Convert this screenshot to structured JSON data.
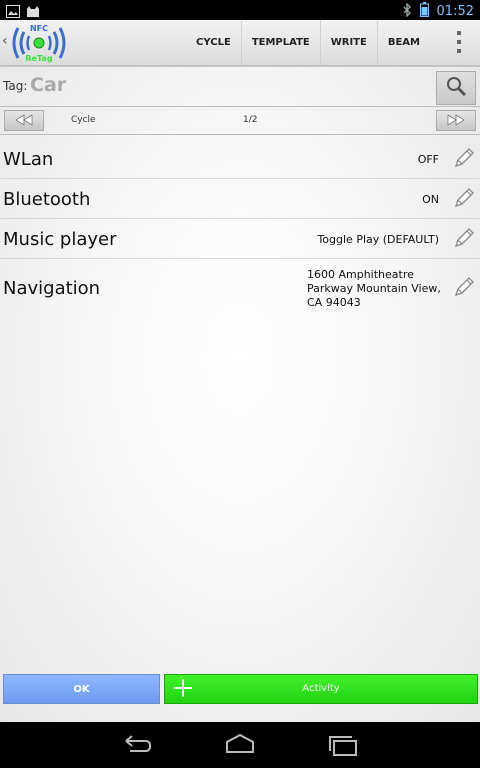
{
  "status_bar": {
    "left_icons": [
      "image-icon",
      "cat-icon"
    ],
    "right_icons": [
      "bluetooth-icon",
      "battery-icon"
    ],
    "time": "01:52"
  },
  "action_bar": {
    "logo_text_top": "NFC",
    "logo_text_bottom": "ReTag",
    "actions": [
      "CYCLE",
      "TEMPLATE",
      "WRITE",
      "BEAM"
    ],
    "overflow_icon": "overflow-menu-icon"
  },
  "tag": {
    "label": "Tag:",
    "value": "Car"
  },
  "nav": {
    "label": "Cycle",
    "page": "1/2"
  },
  "items": [
    {
      "name": "WLan",
      "value": "OFF"
    },
    {
      "name": "Bluetooth",
      "value": "ON"
    },
    {
      "name": "Music player",
      "value": "Toggle Play (DEFAULT)"
    },
    {
      "name": "Navigation",
      "value_lines": [
        "1600 Amphitheatre",
        "Parkway Mountain View,",
        "CA 94043"
      ]
    }
  ],
  "buttons": {
    "ok": "OK",
    "activity": "Activity"
  },
  "colors": {
    "ok_button": "#7ea8f7",
    "activity_button": "#2fe11e",
    "time": "#7fc3ff"
  },
  "system_nav": [
    "back-icon",
    "home-icon",
    "recent-apps-icon"
  ]
}
